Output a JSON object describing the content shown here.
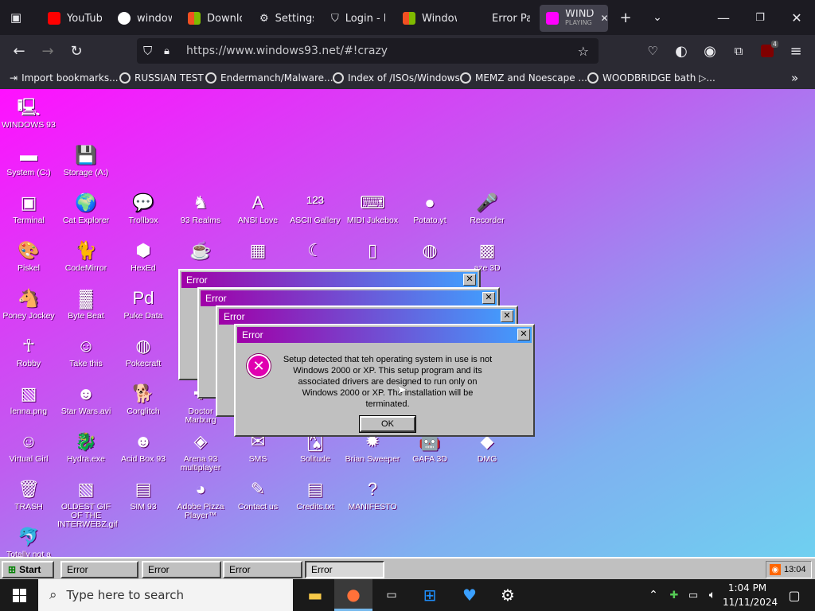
{
  "browser": {
    "tabs": [
      {
        "label": "YouTube",
        "icon": "youtube-icon",
        "color": "#ff0000"
      },
      {
        "label": "windows",
        "icon": "google-icon",
        "color": "#ffffff"
      },
      {
        "label": "Downloa",
        "icon": "windows-logo-icon",
        "color": "#0078d4"
      },
      {
        "label": "Settings",
        "icon": "gear-icon",
        "color": "#dddddd"
      },
      {
        "label": "Login - I",
        "icon": "shield-icon",
        "color": "#dddddd"
      },
      {
        "label": "Window",
        "icon": "windows-logo-icon",
        "color": "#0078d4"
      },
      {
        "label": "Error Pa",
        "icon": "",
        "color": ""
      },
      {
        "label": "WIND",
        "sublabel": "PLAYING",
        "icon": "windows93-icon",
        "color": "#ff00ff",
        "active": true
      }
    ],
    "url": "https://www.windows93.net/#!crazy",
    "extension_badge": "4",
    "bookmarks": [
      {
        "label": "Import bookmarks..."
      },
      {
        "label": "RUSSIAN TEST"
      },
      {
        "label": "Endermanch/Malware..."
      },
      {
        "label": "Index of /ISOs/Windows"
      },
      {
        "label": "MEMZ and Noescape ..."
      },
      {
        "label": "WOODBRIDGE bath ▷..."
      }
    ]
  },
  "desktop": {
    "icons": [
      {
        "label": "WINDOWS 93",
        "icon": "computer-icon"
      },
      {
        "label": "System (C:)",
        "icon": "drive-icon"
      },
      {
        "label": "Storage (A:)",
        "icon": "floppy-drive-icon"
      },
      {
        "label": "Terminal",
        "icon": "terminal-icon"
      },
      {
        "label": "Cat Explorer",
        "icon": "globe-icon"
      },
      {
        "label": "Trollbox",
        "icon": "chat-icon"
      },
      {
        "label": "93 Realms",
        "icon": "knight-icon"
      },
      {
        "label": "ANSI Love",
        "icon": "letter-a-icon"
      },
      {
        "label": "ASCII Gallery",
        "icon": "numbers-icon"
      },
      {
        "label": "MIDI Jukebox",
        "icon": "keyboard-icon"
      },
      {
        "label": "Potato.yt",
        "icon": "potato-icon"
      },
      {
        "label": "Recorder",
        "icon": "microphone-icon"
      },
      {
        "label": "Piskel",
        "icon": "palette-icon"
      },
      {
        "label": "CodeMirror",
        "icon": "cat-icon"
      },
      {
        "label": "HexEd",
        "icon": "cube-icon"
      },
      {
        "label": "Poney Jockey",
        "icon": "pony-icon"
      },
      {
        "label": "Byte Beat",
        "icon": "wave-icon"
      },
      {
        "label": "Puke Data",
        "icon": "pd-icon"
      },
      {
        "label": "Robby",
        "icon": "stickman-icon"
      },
      {
        "label": "Take this",
        "icon": "man-icon"
      },
      {
        "label": "Pokecraft",
        "icon": "ball-icon"
      },
      {
        "label": "lenna.png",
        "icon": "image-file-icon"
      },
      {
        "label": "Star Wars.avi",
        "icon": "yoda-icon"
      },
      {
        "label": "Corglitch",
        "icon": "dog-icon"
      },
      {
        "label": "Doctor Marburg",
        "icon": "doctor-icon"
      },
      {
        "label": "Virtual Girl",
        "icon": "face-icon"
      },
      {
        "label": "Hydra.exe",
        "icon": "dragon-icon"
      },
      {
        "label": "Acid Box 93",
        "icon": "smiley-icon"
      },
      {
        "label": "Arena 93 multiplayer",
        "icon": "cube-3d-icon"
      },
      {
        "label": "SMS",
        "icon": "sms-icon"
      },
      {
        "label": "Solitude",
        "icon": "cards-icon"
      },
      {
        "label": "Brian Sweeper",
        "icon": "bomb-icon"
      },
      {
        "label": "GAFA 3D",
        "icon": "robot-icon"
      },
      {
        "label": "DMG",
        "icon": "dmg-icon"
      },
      {
        "label": "TRASH",
        "icon": "trash-icon"
      },
      {
        "label": "OLDEST GIF OF THE INTERWEBZ.gif",
        "icon": "image-file-icon"
      },
      {
        "label": "SIM 93",
        "icon": "sim-icon"
      },
      {
        "label": "Adobe Pizza Player™",
        "icon": "pizza-icon"
      },
      {
        "label": "Contact us",
        "icon": "contact-icon"
      },
      {
        "label": "Credits.txt",
        "icon": "text-file-icon"
      },
      {
        "label": "MANIFESTO",
        "icon": "question-mark-icon"
      },
      {
        "label": "Totally not a",
        "icon": "dolphin-icon"
      },
      {
        "label": "",
        "icon": "teapot-icon"
      },
      {
        "label": "",
        "icon": "calculator-icon"
      },
      {
        "label": "",
        "icon": "banana-icon"
      },
      {
        "label": "",
        "icon": "file-icon"
      },
      {
        "label": "",
        "icon": "ball-icon"
      },
      {
        "label": "aze 3D",
        "icon": "maze-icon"
      }
    ]
  },
  "dialogs": {
    "title": "Error",
    "message": "Setup detected that teh operating system in use is not Windows 2000 or XP. This setup program and its associated drivers are designed to run only on Windows 2000 or XP. The installation will be terminated.",
    "ok_label": "OK"
  },
  "win93_taskbar": {
    "start_label": "Start",
    "tasks": [
      "Error",
      "Error",
      "Error",
      "Error"
    ],
    "time": "13:04"
  },
  "windows_taskbar": {
    "search_placeholder": "Type here to search",
    "time": "1:04 PM",
    "date": "11/11/2024"
  }
}
